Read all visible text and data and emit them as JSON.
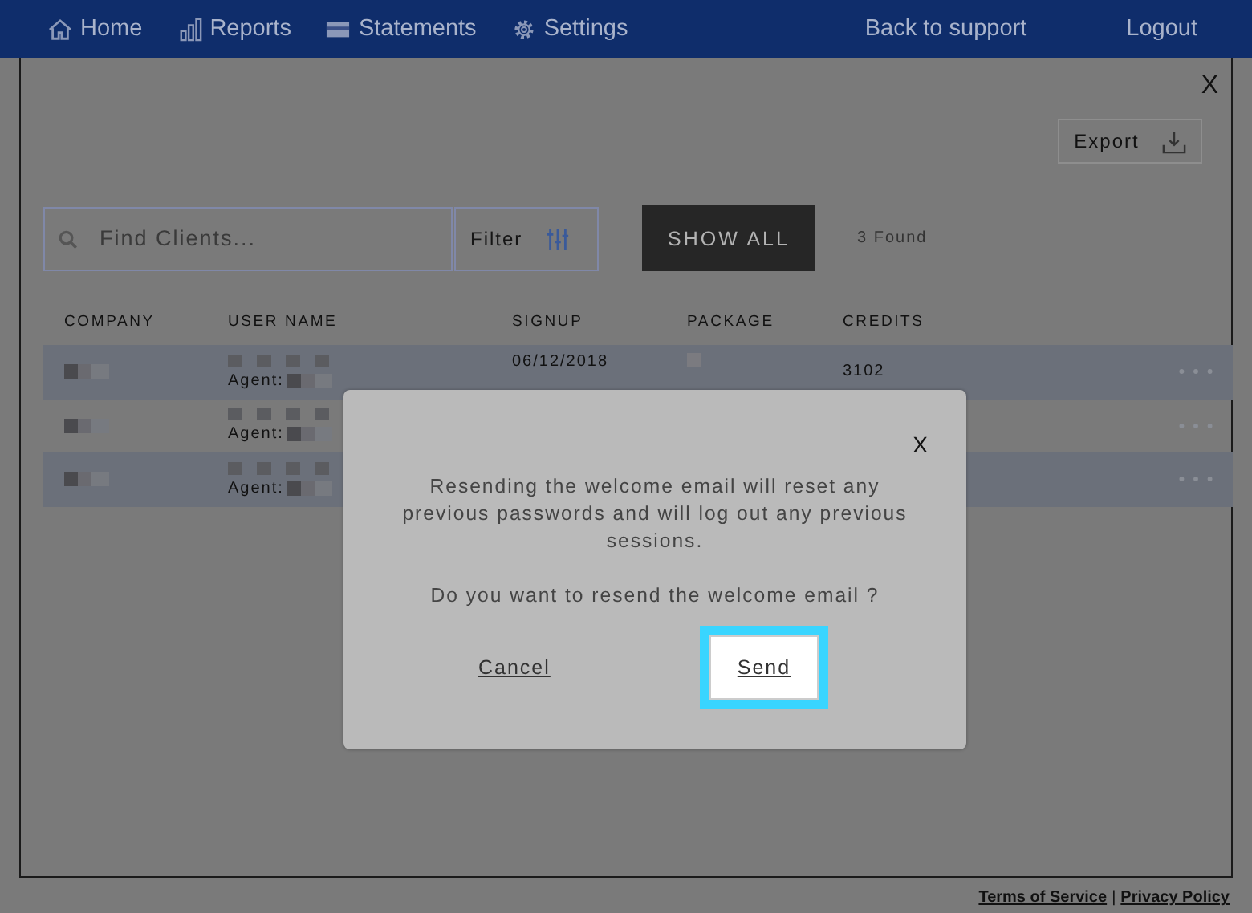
{
  "nav": {
    "items": [
      {
        "label": "Home",
        "kind": "home"
      },
      {
        "label": "Reports",
        "kind": "reports"
      },
      {
        "label": "Statements",
        "kind": "statements"
      },
      {
        "label": "Settings",
        "kind": "settings"
      }
    ],
    "right": [
      "Back to support",
      "Logout"
    ]
  },
  "panel": {
    "close": "X",
    "export": "Export",
    "search": {
      "placeholder": "Find Clients..."
    },
    "filter": "Filter",
    "show_all": "SHOW ALL",
    "found": "3 Found",
    "table": {
      "columns": [
        "COMPANY",
        "USER NAME",
        "SIGNUP",
        "PACKAGE",
        "CREDITS"
      ],
      "rows": [
        {
          "agent": "Agent:",
          "signup": "06/12/2018",
          "credits": "3102"
        },
        {
          "agent": "Agent:"
        },
        {
          "agent": "Agent:"
        }
      ]
    }
  },
  "dialog": {
    "close": "X",
    "message": "Resending the welcome email will reset any previous passwords and will log out any previous sessions.",
    "question": "Do you want to resend the welcome email ?",
    "cancel": "Cancel",
    "confirm": "Send",
    "confirm_focused": true
  },
  "footer": {
    "links": [
      "Terms of Service",
      "Privacy Policy"
    ],
    "separator": "|"
  }
}
